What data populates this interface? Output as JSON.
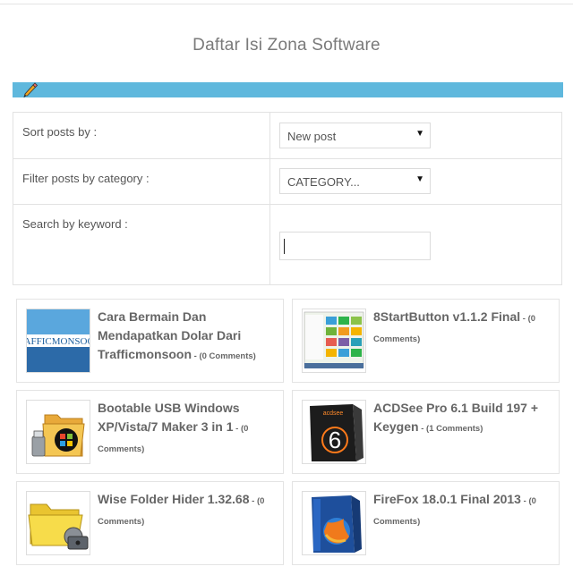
{
  "page_title": "Daftar Isi Zona Software",
  "filters": {
    "sort_label": "Sort posts by :",
    "sort_value": "New post",
    "category_label": "Filter posts by category :",
    "category_value": "CATEGORY...",
    "search_label": "Search by keyword :",
    "search_value": ""
  },
  "posts": [
    {
      "title": "Cara Bermain Dan Mendapatkan Dolar Dari Trafficmonsoon",
      "comments": "(0 Comments)",
      "thumb_text": "AFFICMONSOO"
    },
    {
      "title": "8StartButton v1.1.2 Final",
      "comments": "(0 Comments)"
    },
    {
      "title": "Bootable USB Windows XP/Vista/7 Maker 3 in 1",
      "comments": "(0 Comments)"
    },
    {
      "title": "ACDSee Pro 6.1 Build 197 + Keygen",
      "comments": "(1 Comments)",
      "thumb_text": "6"
    },
    {
      "title": "Wise Folder Hider 1.32.68",
      "comments": "(0 Comments)"
    },
    {
      "title": "FireFox 18.0.1 Final 2013",
      "comments": "(0 Comments)"
    }
  ],
  "colors": {
    "accent_bar": "#5fb8dd"
  },
  "icons": {
    "edit": "pencil-icon",
    "dropdown": "triangle-down-icon"
  }
}
